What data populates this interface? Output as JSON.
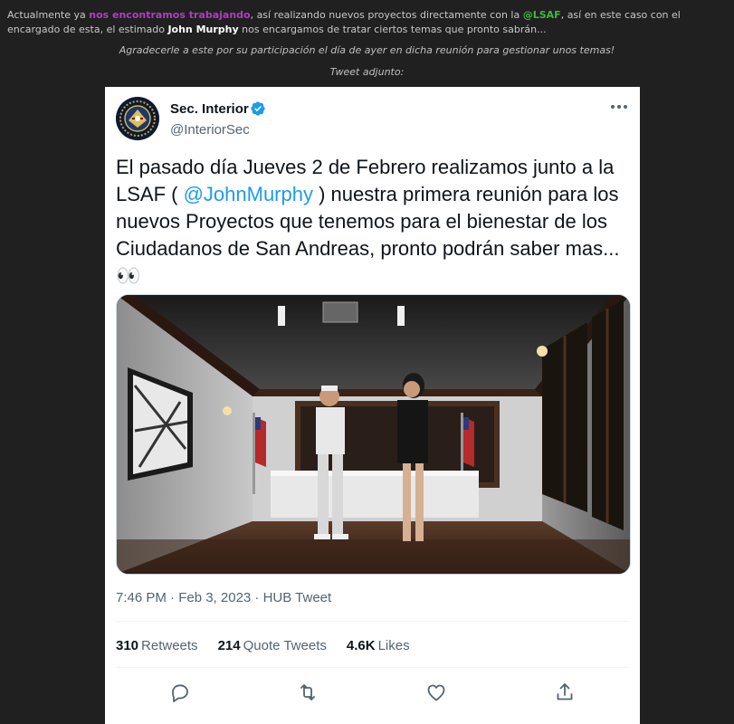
{
  "post": {
    "line1_a": "Actualmente ya ",
    "line1_hl1": "nos encontramos trabajando",
    "line1_b": ", así realizando nuevos proyectos directamente con la ",
    "line1_hl2": "@LSAF",
    "line1_c": ", así en este caso con el encargado de esta, el estimado ",
    "line1_hl3": "John Murphy",
    "line1_d": " nos encargamos de tratar ciertos temas que pronto sabrán...",
    "thanks": "Agradecerle a este por su participación el día de ayer en dicha reunión para gestionar unos temas!",
    "attach_label": "Tweet adjunto:",
    "colors": {
      "mention_purple": "#b13dc2",
      "mention_green": "#3dbb3d",
      "background": "#202020"
    }
  },
  "tweet": {
    "display_name": "Sec. Interior",
    "handle": "@InteriorSec",
    "text_a": "El pasado día Jueves 2 de Febrero realizamos junto a la LSAF ( ",
    "mention": "@JohnMurphy",
    "text_b": " ) nuestra primera reunión para los nuevos Proyectos que tenemos para el bienestar de los Ciudadanos de San Andreas, pronto podrán saber mas... 👀",
    "timestamp": "7:46 PM · Feb 3, 2023 · HUB Tweet",
    "retweets_count": "310",
    "retweets_label": "Retweets",
    "quotes_count": "214",
    "quotes_label": "Quote Tweets",
    "likes_count": "4.6K",
    "likes_label": "Likes",
    "icons": [
      "verified-badge-icon",
      "more-options-icon",
      "reply-icon",
      "retweet-icon",
      "like-icon",
      "share-icon"
    ],
    "accent_color": "#1d9bf0"
  }
}
